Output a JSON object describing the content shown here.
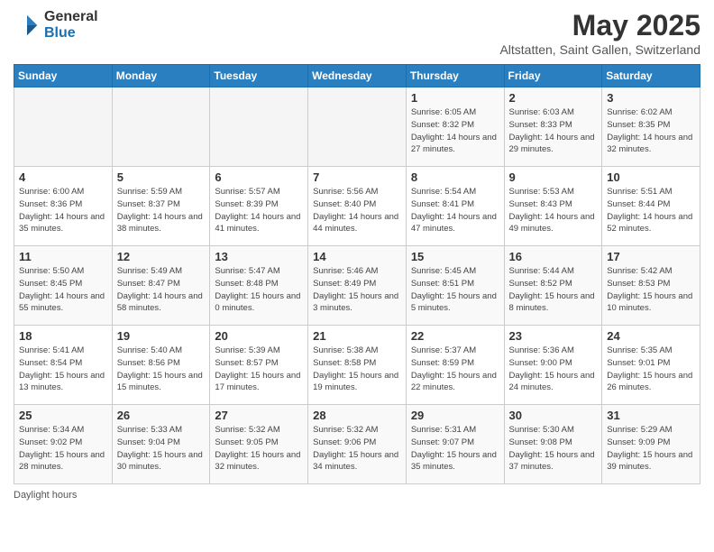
{
  "header": {
    "logo_general": "General",
    "logo_blue": "Blue",
    "month_title": "May 2025",
    "location": "Altstatten, Saint Gallen, Switzerland"
  },
  "days_of_week": [
    "Sunday",
    "Monday",
    "Tuesday",
    "Wednesday",
    "Thursday",
    "Friday",
    "Saturday"
  ],
  "weeks": [
    [
      {
        "day": "",
        "info": ""
      },
      {
        "day": "",
        "info": ""
      },
      {
        "day": "",
        "info": ""
      },
      {
        "day": "",
        "info": ""
      },
      {
        "day": "1",
        "info": "Sunrise: 6:05 AM\nSunset: 8:32 PM\nDaylight: 14 hours and 27 minutes."
      },
      {
        "day": "2",
        "info": "Sunrise: 6:03 AM\nSunset: 8:33 PM\nDaylight: 14 hours and 29 minutes."
      },
      {
        "day": "3",
        "info": "Sunrise: 6:02 AM\nSunset: 8:35 PM\nDaylight: 14 hours and 32 minutes."
      }
    ],
    [
      {
        "day": "4",
        "info": "Sunrise: 6:00 AM\nSunset: 8:36 PM\nDaylight: 14 hours and 35 minutes."
      },
      {
        "day": "5",
        "info": "Sunrise: 5:59 AM\nSunset: 8:37 PM\nDaylight: 14 hours and 38 minutes."
      },
      {
        "day": "6",
        "info": "Sunrise: 5:57 AM\nSunset: 8:39 PM\nDaylight: 14 hours and 41 minutes."
      },
      {
        "day": "7",
        "info": "Sunrise: 5:56 AM\nSunset: 8:40 PM\nDaylight: 14 hours and 44 minutes."
      },
      {
        "day": "8",
        "info": "Sunrise: 5:54 AM\nSunset: 8:41 PM\nDaylight: 14 hours and 47 minutes."
      },
      {
        "day": "9",
        "info": "Sunrise: 5:53 AM\nSunset: 8:43 PM\nDaylight: 14 hours and 49 minutes."
      },
      {
        "day": "10",
        "info": "Sunrise: 5:51 AM\nSunset: 8:44 PM\nDaylight: 14 hours and 52 minutes."
      }
    ],
    [
      {
        "day": "11",
        "info": "Sunrise: 5:50 AM\nSunset: 8:45 PM\nDaylight: 14 hours and 55 minutes."
      },
      {
        "day": "12",
        "info": "Sunrise: 5:49 AM\nSunset: 8:47 PM\nDaylight: 14 hours and 58 minutes."
      },
      {
        "day": "13",
        "info": "Sunrise: 5:47 AM\nSunset: 8:48 PM\nDaylight: 15 hours and 0 minutes."
      },
      {
        "day": "14",
        "info": "Sunrise: 5:46 AM\nSunset: 8:49 PM\nDaylight: 15 hours and 3 minutes."
      },
      {
        "day": "15",
        "info": "Sunrise: 5:45 AM\nSunset: 8:51 PM\nDaylight: 15 hours and 5 minutes."
      },
      {
        "day": "16",
        "info": "Sunrise: 5:44 AM\nSunset: 8:52 PM\nDaylight: 15 hours and 8 minutes."
      },
      {
        "day": "17",
        "info": "Sunrise: 5:42 AM\nSunset: 8:53 PM\nDaylight: 15 hours and 10 minutes."
      }
    ],
    [
      {
        "day": "18",
        "info": "Sunrise: 5:41 AM\nSunset: 8:54 PM\nDaylight: 15 hours and 13 minutes."
      },
      {
        "day": "19",
        "info": "Sunrise: 5:40 AM\nSunset: 8:56 PM\nDaylight: 15 hours and 15 minutes."
      },
      {
        "day": "20",
        "info": "Sunrise: 5:39 AM\nSunset: 8:57 PM\nDaylight: 15 hours and 17 minutes."
      },
      {
        "day": "21",
        "info": "Sunrise: 5:38 AM\nSunset: 8:58 PM\nDaylight: 15 hours and 19 minutes."
      },
      {
        "day": "22",
        "info": "Sunrise: 5:37 AM\nSunset: 8:59 PM\nDaylight: 15 hours and 22 minutes."
      },
      {
        "day": "23",
        "info": "Sunrise: 5:36 AM\nSunset: 9:00 PM\nDaylight: 15 hours and 24 minutes."
      },
      {
        "day": "24",
        "info": "Sunrise: 5:35 AM\nSunset: 9:01 PM\nDaylight: 15 hours and 26 minutes."
      }
    ],
    [
      {
        "day": "25",
        "info": "Sunrise: 5:34 AM\nSunset: 9:02 PM\nDaylight: 15 hours and 28 minutes."
      },
      {
        "day": "26",
        "info": "Sunrise: 5:33 AM\nSunset: 9:04 PM\nDaylight: 15 hours and 30 minutes."
      },
      {
        "day": "27",
        "info": "Sunrise: 5:32 AM\nSunset: 9:05 PM\nDaylight: 15 hours and 32 minutes."
      },
      {
        "day": "28",
        "info": "Sunrise: 5:32 AM\nSunset: 9:06 PM\nDaylight: 15 hours and 34 minutes."
      },
      {
        "day": "29",
        "info": "Sunrise: 5:31 AM\nSunset: 9:07 PM\nDaylight: 15 hours and 35 minutes."
      },
      {
        "day": "30",
        "info": "Sunrise: 5:30 AM\nSunset: 9:08 PM\nDaylight: 15 hours and 37 minutes."
      },
      {
        "day": "31",
        "info": "Sunrise: 5:29 AM\nSunset: 9:09 PM\nDaylight: 15 hours and 39 minutes."
      }
    ]
  ],
  "footer": {
    "note": "Daylight hours"
  }
}
